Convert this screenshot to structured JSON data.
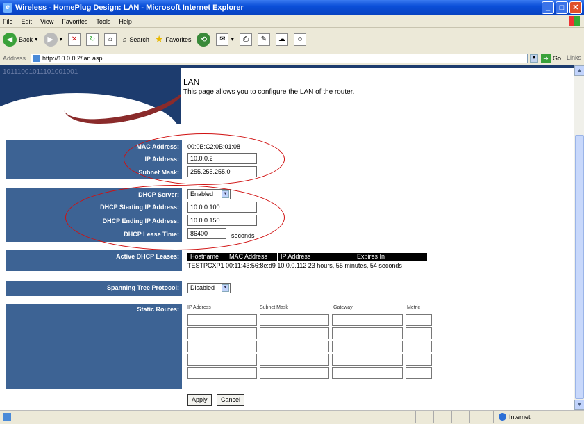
{
  "window": {
    "title": "Wireless - HomePlug Design: LAN - Microsoft Internet Explorer"
  },
  "menu": [
    "File",
    "Edit",
    "View",
    "Favorites",
    "Tools",
    "Help"
  ],
  "toolbar": {
    "back": "Back",
    "search": "Search",
    "favorites": "Favorites"
  },
  "address": {
    "label": "Address",
    "url": "http://10.0.0.2/lan.asp",
    "go": "Go",
    "links": "Links"
  },
  "page": {
    "header_binary": "10111001011101001001",
    "title": "LAN",
    "description": "This page allows you to configure the LAN of the router.",
    "lan": {
      "mac_label": "MAC Address:",
      "mac_value": "00:0B:C2:0B:01:08",
      "ip_label": "IP Address:",
      "ip_value": "10.0.0.2",
      "mask_label": "Subnet Mask:",
      "mask_value": "255.255.255.0"
    },
    "dhcp": {
      "server_label": "DHCP Server:",
      "server_value": "Enabled",
      "start_label": "DHCP Starting IP Address:",
      "start_value": "10.0.0.100",
      "end_label": "DHCP Ending IP Address:",
      "end_value": "10.0.0.150",
      "lease_label": "DHCP Lease Time:",
      "lease_value": "86400",
      "lease_unit": "seconds"
    },
    "leases": {
      "label": "Active DHCP Leases:",
      "headers": [
        "Hostname",
        "MAC Address",
        "IP Address",
        "Expires In"
      ],
      "row": "TESTPCXP1 00:11:43:56:8e:d9 10.0.0.112 23 hours, 55 minutes, 54 seconds"
    },
    "stp": {
      "label": "Spanning Tree Protocol:",
      "value": "Disabled"
    },
    "routes": {
      "label": "Static Routes:",
      "headers": [
        "IP Address",
        "Subnet Mask",
        "Gateway",
        "Metric"
      ]
    },
    "buttons": {
      "apply": "Apply",
      "cancel": "Cancel"
    }
  },
  "status": {
    "zone": "Internet"
  },
  "colors": {
    "panel": "#3d6394",
    "header": "#1d3c6e",
    "annotation": "#d01010"
  }
}
